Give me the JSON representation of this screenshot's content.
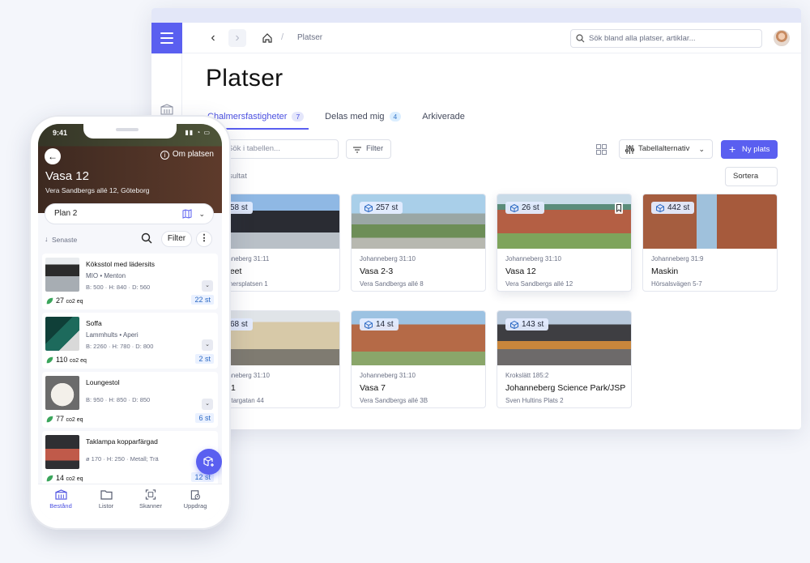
{
  "desktop": {
    "breadcrumb": "Platser",
    "search_placeholder": "Sök bland alla platser, artiklar...",
    "title": "Platser",
    "tabs": [
      {
        "label": "Chalmersfastigheter",
        "count": "7"
      },
      {
        "label": "Delas med mig",
        "count": "4"
      },
      {
        "label": "Arkiverade",
        "count": ""
      }
    ],
    "table_search_placeholder": "Sök i tabellen...",
    "filter_label": "Filter",
    "table_options_label": "Tabellalternativ",
    "new_place_label": "Ny plats",
    "sort_label": "Sortera",
    "result_label": "Resultat",
    "cards": [
      {
        "count": "58 st",
        "meta": "Johanneberg 31:11",
        "name": "Museet",
        "addr": "Chalmersplatsen 1"
      },
      {
        "count": "257 st",
        "meta": "Johanneberg 31:10",
        "name": "Vasa 2-3",
        "addr": "Vera Sandbergs allé 8"
      },
      {
        "count": "26 st",
        "meta": "Johanneberg 31:10",
        "name": "Vasa 12",
        "addr": "Vera Sandbergs allé 12"
      },
      {
        "count": "442 st",
        "meta": "Johanneberg 31:9",
        "name": "Maskin",
        "addr": "Hörsalsvägen 5-7"
      },
      {
        "count": "68 st",
        "meta": "Johanneberg 31:10",
        "name": "GW 1",
        "addr": "Gibraltargatan 44"
      },
      {
        "count": "14 st",
        "meta": "Johanneberg 31:10",
        "name": "Vasa 7",
        "addr": "Vera Sandbergs allé 3B"
      },
      {
        "count": "143 st",
        "meta": "Krokslätt 185:2",
        "name": "Johanneberg Science Park/JSP",
        "addr": "Sven Hultins Plats 2"
      }
    ]
  },
  "phone": {
    "time": "9:41",
    "about_label": "Om platsen",
    "place_name": "Vasa 12",
    "place_address": "Vera Sandbergs allé 12, Göteborg",
    "plan_label": "Plan 2",
    "sort_label": "Senaste",
    "filter_label": "Filter",
    "items": [
      {
        "title": "Köksstol med lädersits",
        "brand": "MIO • Menton",
        "dims": "B: 500 · H: 840 · D: 560",
        "co2": "27",
        "co2_unit": "co2 eq",
        "qty": "22 st"
      },
      {
        "title": "Soffa",
        "brand": "Lammhults • Aperi",
        "dims": "B: 2260 · H: 780 · D: 800",
        "co2": "110",
        "co2_unit": "co2 eq",
        "qty": "2 st"
      },
      {
        "title": "Loungestol",
        "brand": "",
        "dims": "B: 950 · H: 850 · D: 850",
        "co2": "77",
        "co2_unit": "co2 eq",
        "qty": "6 st"
      },
      {
        "title": "Taklampa kopparfärgad",
        "brand": "",
        "dims": "ø 170 · H: 250 · Metall; Trä",
        "co2": "14",
        "co2_unit": "co2 eq",
        "qty": "12 st"
      }
    ],
    "nav": [
      {
        "label": "Bestånd"
      },
      {
        "label": "Listor"
      },
      {
        "label": "Skanner"
      },
      {
        "label": "Uppdrag"
      }
    ]
  },
  "colors": {
    "accent": "#5a5ff0",
    "co2_green": "#3aa55b",
    "qty_blue": "#2b69c4"
  }
}
